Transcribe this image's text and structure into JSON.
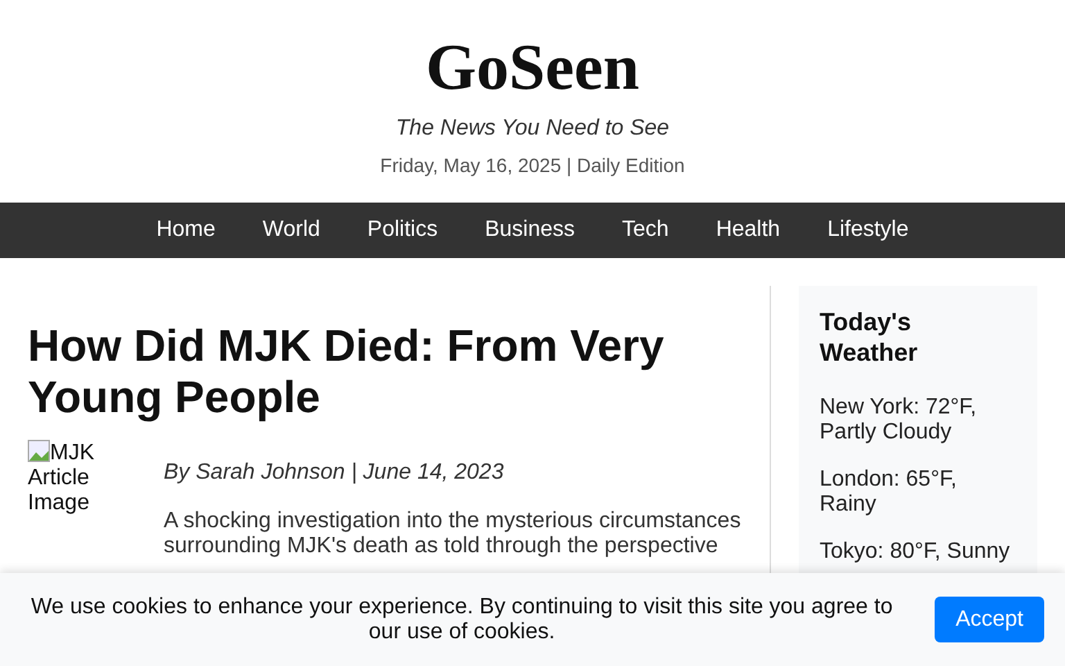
{
  "site": {
    "logo": "GoSeen",
    "tagline": "The News You Need to See",
    "edition": "Friday, May 16, 2025 | Daily Edition"
  },
  "nav": [
    {
      "label": "Home"
    },
    {
      "label": "World"
    },
    {
      "label": "Politics"
    },
    {
      "label": "Business"
    },
    {
      "label": "Tech"
    },
    {
      "label": "Health"
    },
    {
      "label": "Lifestyle"
    }
  ],
  "article": {
    "title": "How Did MJK Died: From Very Young People",
    "image_alt": "MJK Article Image",
    "byline": "By Sarah Johnson | June 14, 2023",
    "body": "A shocking investigation into the mysterious circumstances surrounding MJK's death as told through the perspective"
  },
  "weather": {
    "title": "Today's Weather",
    "items": [
      "New York: 72°F, Partly Cloudy",
      "London: 65°F, Rainy",
      "Tokyo: 80°F, Sunny"
    ]
  },
  "cookie_banner": {
    "text": "We use cookies to enhance your experience. By continuing to visit this site you agree to our use of cookies.",
    "button": "Accept"
  }
}
